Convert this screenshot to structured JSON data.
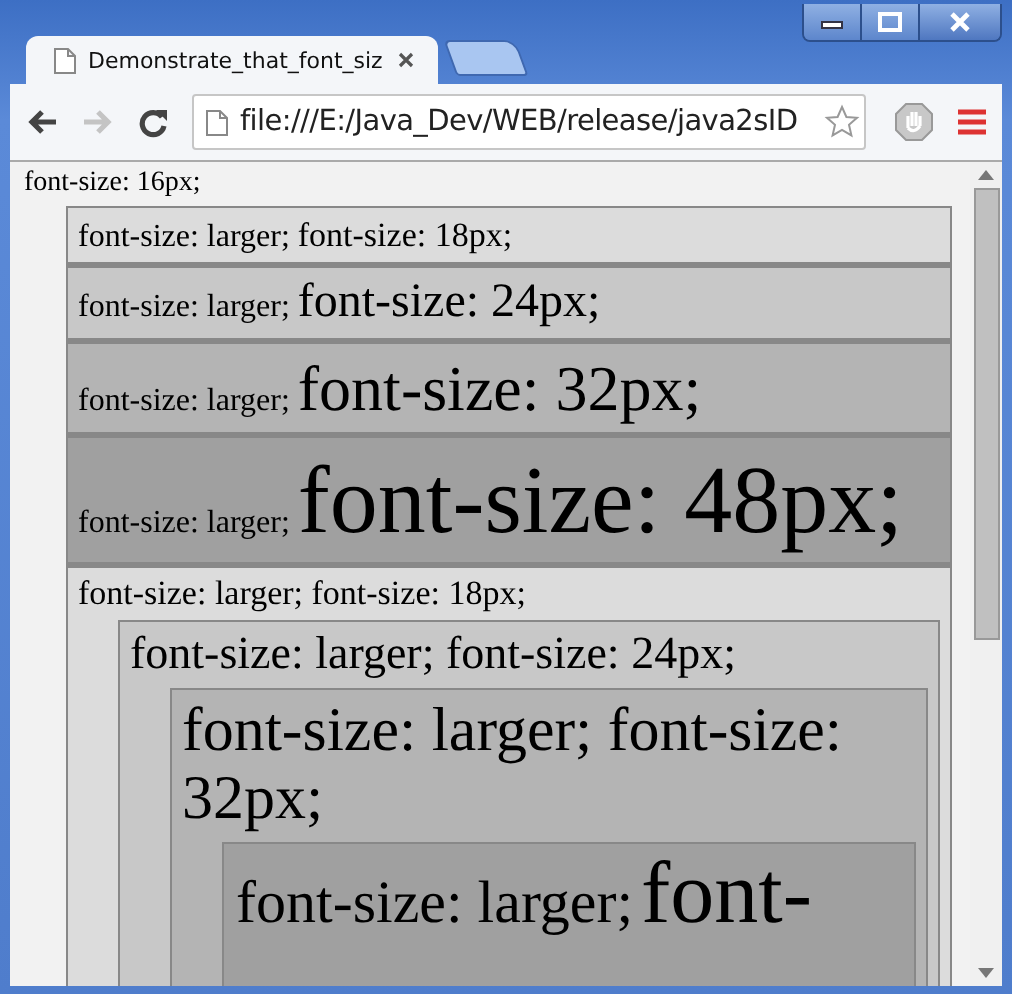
{
  "tabs": [
    {
      "title": "Demonstrate_that_font_siz",
      "selected": true
    }
  ],
  "nav_buttons": [
    {
      "kind": "back",
      "disabled": false
    },
    {
      "kind": "forward",
      "disabled": true
    },
    {
      "kind": "reload",
      "disabled": false
    }
  ],
  "address_bar": {
    "value": "file:///E:/Java_Dev/WEB/release/java2sID"
  },
  "page": {
    "root_text": "font-size: 16px;",
    "flat_boxes": [
      {
        "prefix": "font-size: larger;",
        "label": "font-size: 18px;"
      },
      {
        "prefix": "font-size: larger;",
        "label": "font-size: 24px;"
      },
      {
        "prefix": "font-size: larger;",
        "label": "font-size: 32px;"
      },
      {
        "prefix": "font-size: larger;",
        "label": "font-size: 48px;"
      }
    ],
    "nested_box": {
      "prefix": "font-size: larger;",
      "label": "font-size: 18px;",
      "children": [
        {
          "prefix": "font-size: larger;",
          "label": "font-size: 24px;",
          "children": [
            {
              "prefix": "font-size: larger;",
              "label": "font-size: 32px;",
              "children": [
                {
                  "prefix": "font-size: larger;",
                  "label": "font-"
                }
              ]
            }
          ]
        }
      ]
    }
  }
}
